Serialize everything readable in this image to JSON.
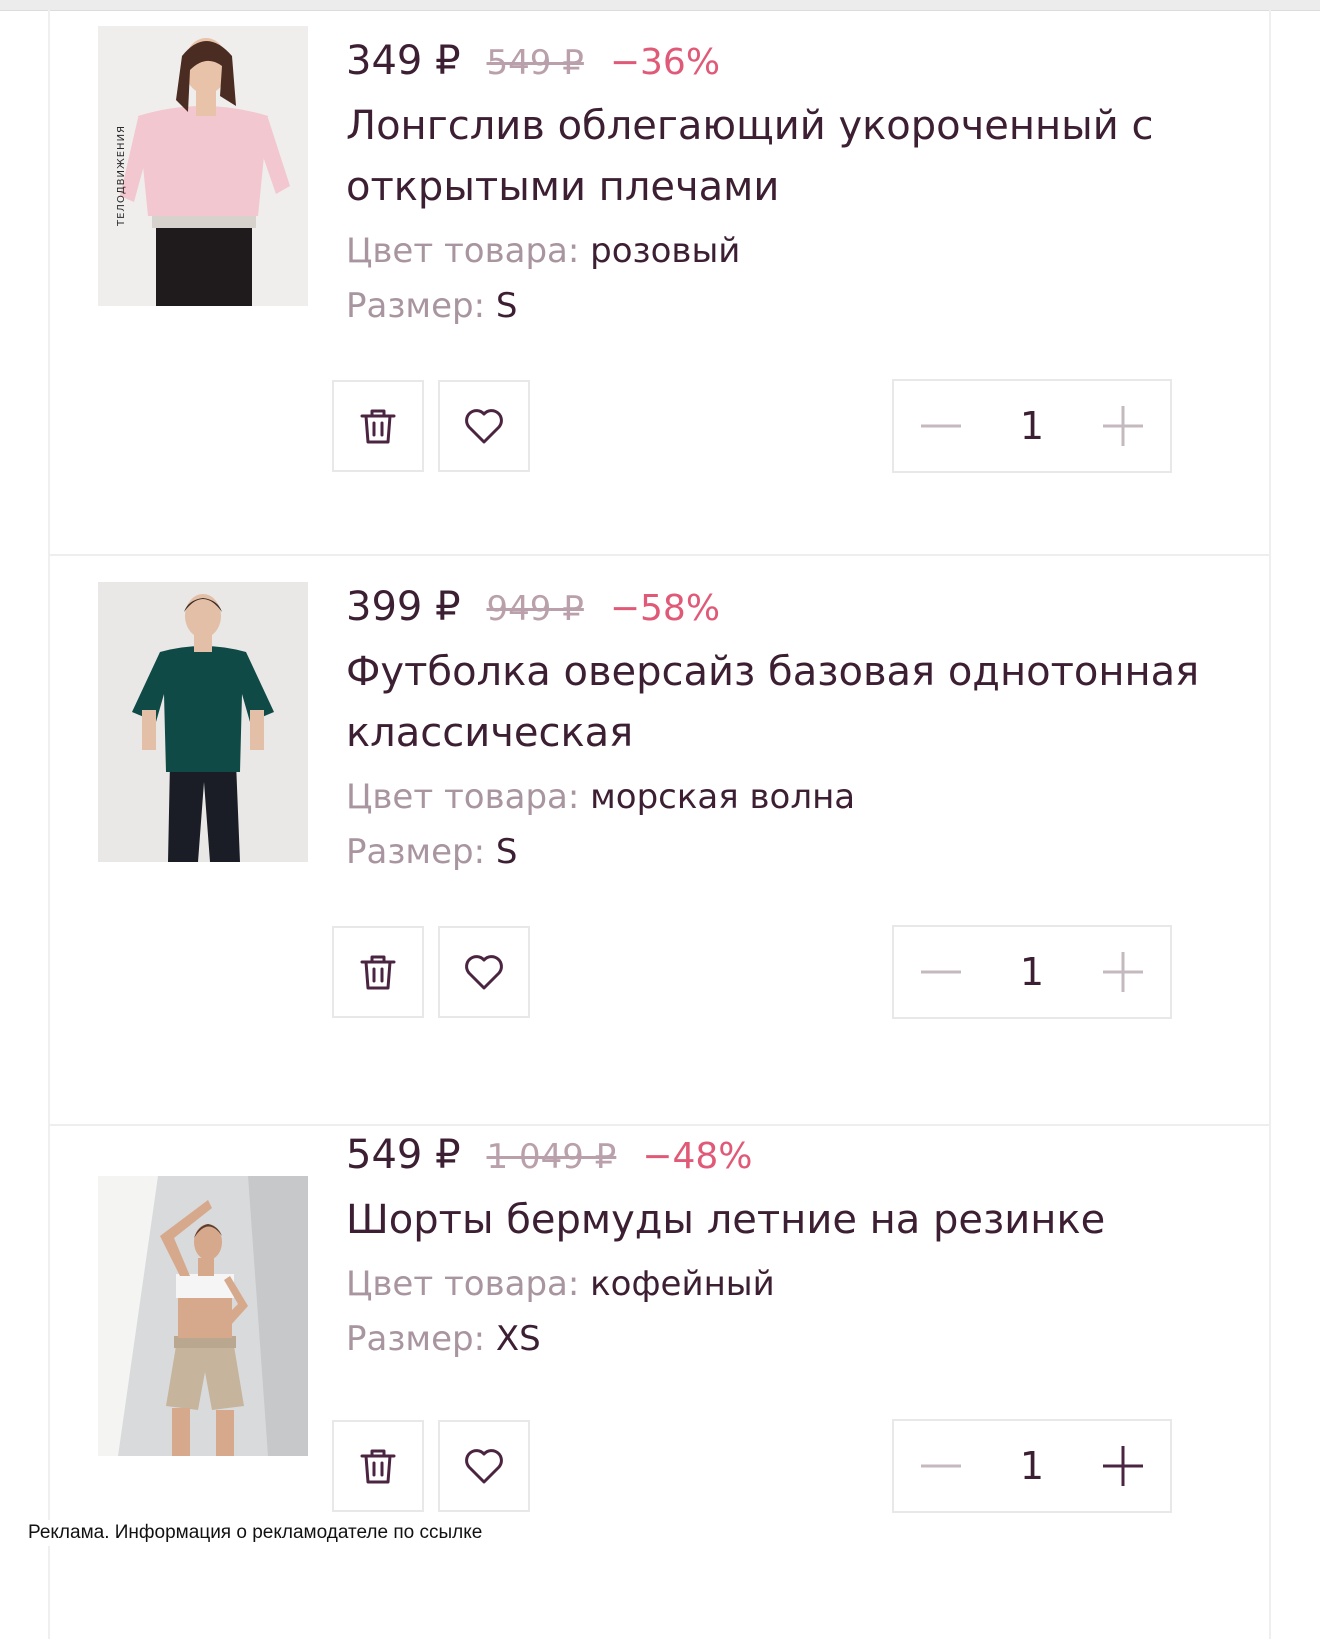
{
  "products": [
    {
      "price": "349 ₽",
      "old_price": "549 ₽",
      "discount": "−36%",
      "title": "Лонгслив облегающий укороченный с открытыми плечами",
      "color_label": "Цвет товара:",
      "color_value": "розовый",
      "size_label": "Размер:",
      "size_value": "S",
      "quantity": "1",
      "photo_brand_text": "ТЕЛОДВИЖЕНИЯ"
    },
    {
      "price": "399 ₽",
      "old_price": "949 ₽",
      "discount": "−58%",
      "title": "Футболка оверсайз базовая однотонная классическая",
      "color_label": "Цвет товара:",
      "color_value": "морская волна",
      "size_label": "Размер:",
      "size_value": "S",
      "quantity": "1"
    },
    {
      "price": "549 ₽",
      "old_price": "1 049 ₽",
      "discount": "−48%",
      "title": "Шорты бермуды летние на резинке",
      "color_label": "Цвет товара:",
      "color_value": "кофейный",
      "size_label": "Размер:",
      "size_value": "XS",
      "quantity": "1"
    }
  ],
  "ad_notice": "Реклама. Информация о рекламодателе по ссылке",
  "colors": {
    "text": "#3d1f33",
    "muted": "#a8959f",
    "discount": "#e05a78",
    "border": "#e8e8e8"
  },
  "icons": [
    "trash-icon",
    "heart-icon",
    "minus-icon",
    "plus-icon"
  ]
}
